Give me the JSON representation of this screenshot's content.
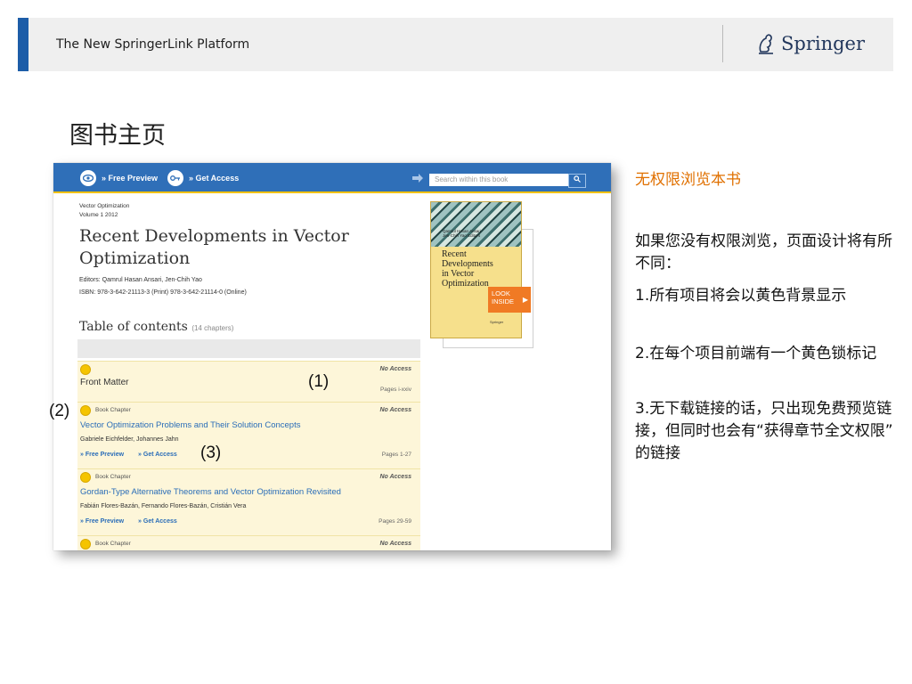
{
  "header": {
    "title": "The New SpringerLink Platform",
    "brand": "Springer"
  },
  "slide_title": "图书主页",
  "screenshot": {
    "topbar": {
      "free_preview": "» Free Preview",
      "get_access": "» Get Access",
      "search_placeholder": "Search within this book"
    },
    "book": {
      "series": "Vector Optimization",
      "volume": "Volume 1 2012",
      "title": "Recent Developments in Vector Optimization",
      "editors": "Editors: Qamrul Hasan Ansari, Jen-Chih Yao",
      "isbn": "ISBN: 978-3-642-21113-3 (Print) 978-3-642-21114-0 (Online)"
    },
    "toc": {
      "heading": "Table of contents",
      "count": "(14 chapters)"
    },
    "front_matter": {
      "title": "Front Matter",
      "access": "No Access",
      "pages": "Pages i-xxiv"
    },
    "chapters": [
      {
        "kind": "Book Chapter",
        "access": "No Access",
        "title": "Vector Optimization Problems and Their Solution Concepts",
        "authors": "Gabriele Eichfelder, Johannes Jahn",
        "free_preview": "» Free Preview",
        "get_access": "» Get Access",
        "pages": "Pages 1-27"
      },
      {
        "kind": "Book Chapter",
        "access": "No Access",
        "title": "Gordan-Type Alternative Theorems and Vector Optimization Revisited",
        "authors": "Fabián Flores-Bazán, Fernando Flores-Bazán, Cristián Vera",
        "free_preview": "» Free Preview",
        "get_access": "» Get Access",
        "pages": "Pages 29-59"
      },
      {
        "kind": "Book Chapter",
        "access": "No Access"
      }
    ],
    "cover": {
      "authors_line1": "Qamrul Hasan Ansari",
      "authors_line2": "Jen-Chih Yao  Editors",
      "title_lines": [
        "Recent",
        "Developments",
        "in Vector",
        "Optimization"
      ],
      "look_inside_line1": "LOOK",
      "look_inside_line2": "INSIDE",
      "publisher": "Springer"
    }
  },
  "callouts": {
    "one": "(1)",
    "two": "(2)",
    "three": "(3)"
  },
  "side_panel": {
    "heading": "无权限浏览本书",
    "intro": "如果您没有权限浏览，页面设计将有所不同：",
    "point1": "1.所有项目将会以黄色背景显示",
    "point2": "2.在每个项目前端有一个黄色锁标记",
    "point3": "3.无下载链接的话，只出现免费预览链接，但同时也会有“获得章节全文权限” 的链接"
  },
  "colors": {
    "accent_blue": "#1d5da8",
    "topbar_blue": "#2f6fb8",
    "no_access_yellow": "#fdf6d9",
    "lock_yellow": "#f5c400",
    "side_heading_orange": "#e07000",
    "look_inside_orange": "#f07a24"
  }
}
